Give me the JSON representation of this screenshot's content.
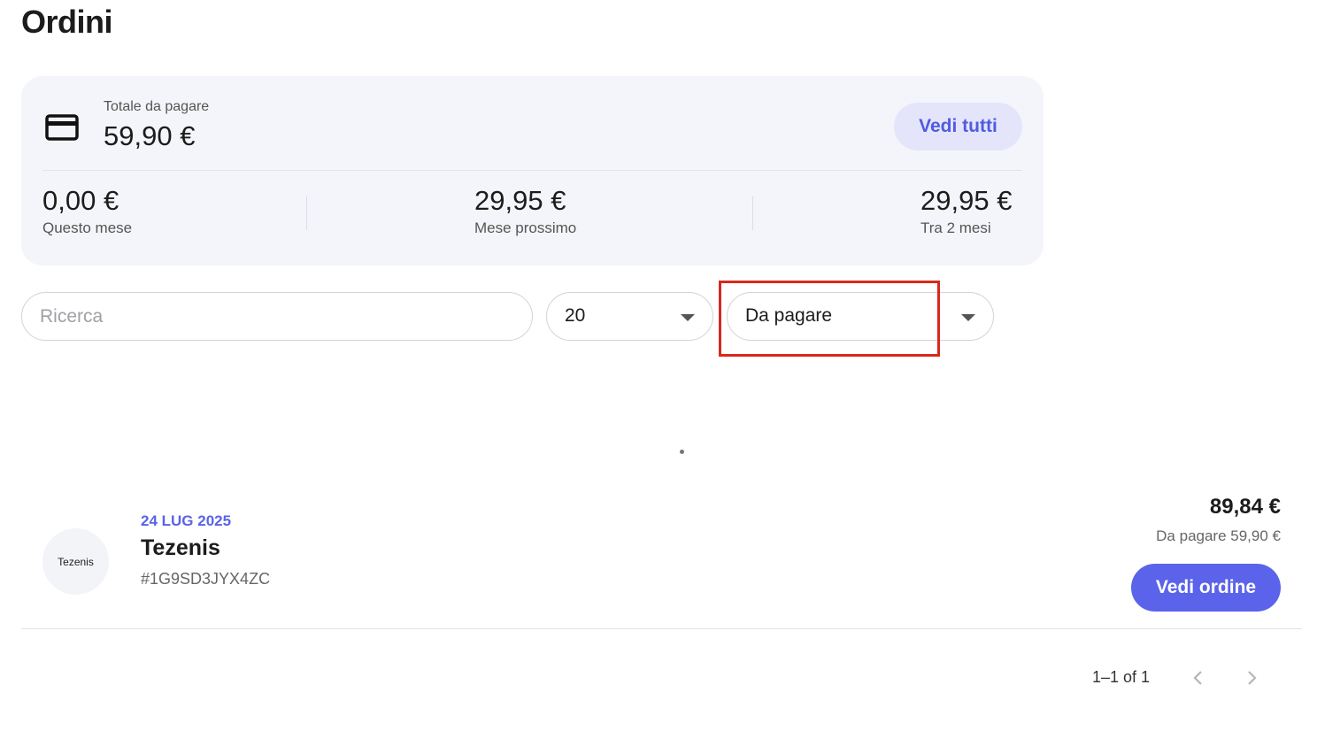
{
  "page": {
    "title": "Ordini"
  },
  "summary": {
    "total_label": "Totale da pagare",
    "total_amount": "59,90 €",
    "view_all_label": "Vedi tutti",
    "card_icon": "credit-card-icon",
    "stats": [
      {
        "value": "0,00 €",
        "label": "Questo mese"
      },
      {
        "value": "29,95 €",
        "label": "Mese prossimo"
      },
      {
        "value": "29,95 €",
        "label": "Tra 2 mesi"
      }
    ]
  },
  "filters": {
    "search_placeholder": "Ricerca",
    "page_size": "20",
    "status": "Da pagare"
  },
  "orders": [
    {
      "merchant_logo_text": "Tezenis",
      "date": "24 LUG 2025",
      "merchant": "Tezenis",
      "order_id": "#1G9SD3JYX4ZC",
      "total": "89,84 €",
      "due": "Da pagare 59,90 €",
      "view_label": "Vedi ordine"
    }
  ],
  "pagination": {
    "range": "1–1 of 1"
  },
  "colors": {
    "accent": "#5a63ea",
    "highlight": "#d9281a",
    "card_bg": "#f4f5fa"
  }
}
